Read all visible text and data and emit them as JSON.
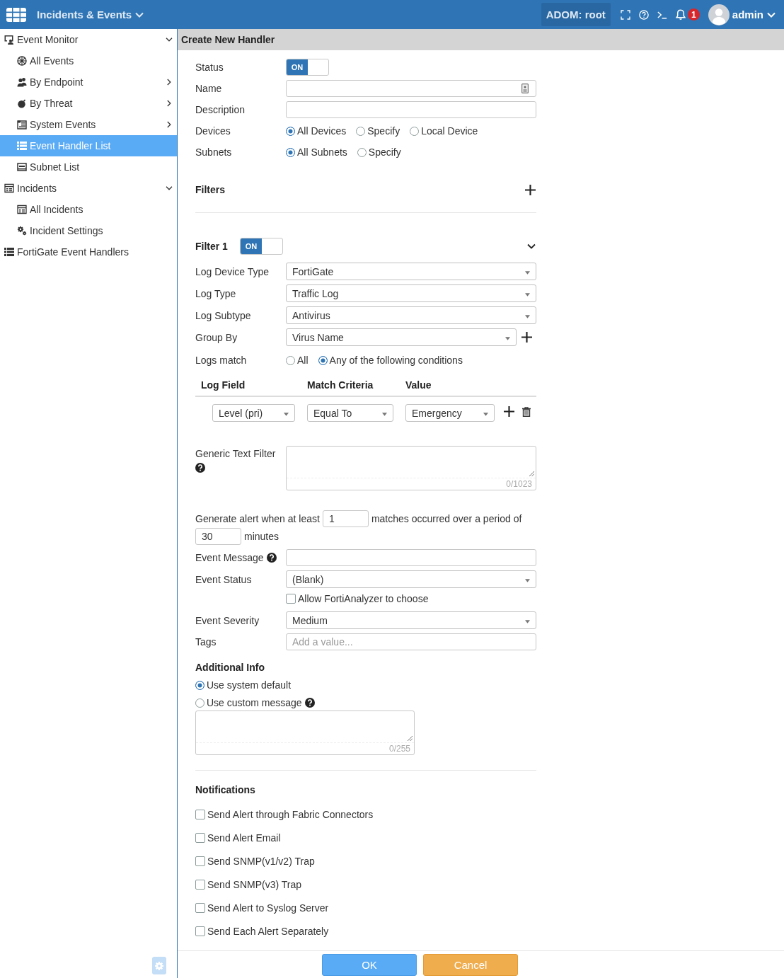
{
  "top_bar": {
    "app_title": "Incidents & Events",
    "adom": "ADOM: root",
    "alert_count": "1",
    "user": "admin"
  },
  "sidebar": {
    "items": [
      {
        "label": "Event Monitor",
        "kind": "branch",
        "expanded": true,
        "selected": false,
        "children": [
          {
            "label": "All Events",
            "kind": "leaf",
            "selected": false
          },
          {
            "label": "By Endpoint",
            "kind": "branch",
            "expanded": false,
            "selected": false
          },
          {
            "label": "By Threat",
            "kind": "branch",
            "expanded": false,
            "selected": false
          },
          {
            "label": "System Events",
            "kind": "branch",
            "expanded": false,
            "selected": false
          },
          {
            "label": "Event Handler List",
            "kind": "leaf",
            "selected": true
          },
          {
            "label": "Subnet List",
            "kind": "leaf",
            "selected": false
          }
        ]
      },
      {
        "label": "Incidents",
        "kind": "branch",
        "expanded": true,
        "selected": false,
        "children": [
          {
            "label": "All Incidents",
            "kind": "leaf",
            "selected": false
          },
          {
            "label": "Incident Settings",
            "kind": "leaf",
            "selected": false
          }
        ]
      },
      {
        "label": "FortiGate Event Handlers",
        "kind": "leaf",
        "selected": false
      }
    ]
  },
  "panel": {
    "title": "Create New Handler"
  },
  "general": [
    {
      "kind": "toggle",
      "label": "Status",
      "on": true,
      "toggle_text": "ON"
    },
    {
      "kind": "lookup",
      "label": "Name"
    },
    {
      "kind": "input",
      "label": "Description"
    },
    {
      "kind": "radio",
      "label": "Devices",
      "options": [
        {
          "label": "All Devices",
          "selected": true
        },
        {
          "label": "Specify",
          "selected": false
        },
        {
          "label": "Local Device",
          "selected": false
        }
      ]
    },
    {
      "kind": "radio",
      "label": "Subnets",
      "options": [
        {
          "label": "All Subnets",
          "selected": true
        },
        {
          "label": "Specify",
          "selected": false
        }
      ]
    }
  ],
  "filters": {
    "title": "Filters",
    "items": [
      {
        "title": "Filter 1",
        "on": true,
        "toggle_text": "ON",
        "expanded": true,
        "fields": [
          {
            "kind": "select",
            "label": "Log Device Type",
            "value": "FortiGate"
          },
          {
            "kind": "select",
            "label": "Log Type",
            "value": "Traffic Log"
          },
          {
            "kind": "select",
            "label": "Log Subtype",
            "value": "Antivirus"
          },
          {
            "kind": "selectadd",
            "label": "Group By",
            "value": "Virus Name"
          },
          {
            "kind": "radio",
            "label": "Logs match",
            "options": [
              {
                "label": "All",
                "selected": false
              },
              {
                "label": "Any of the following conditions",
                "selected": true
              }
            ]
          }
        ],
        "conditions": {
          "columns": [
            "Log Field",
            "Match Criteria",
            "Value"
          ],
          "rows": [
            {
              "log_field": "Level (pri)",
              "match_criteria": "Equal To",
              "value": "Emergency"
            }
          ]
        },
        "text_filter": {
          "label": "Generic Text Filter",
          "counter": "0/1023"
        }
      }
    ]
  },
  "alert_rule": {
    "prefix": "Generate alert when at least",
    "matches": "1",
    "middle": "matches occurred over a period of",
    "period": "30",
    "suffix": "minutes"
  },
  "event": [
    {
      "kind": "input",
      "label": "Event Message",
      "help": true
    },
    {
      "kind": "select",
      "label": "Event Status",
      "value": "(Blank)",
      "help": false
    },
    {
      "kind": "checkbox",
      "label": "Allow FortiAnalyzer to choose",
      "checked": false,
      "help": false
    },
    {
      "kind": "select",
      "label": "Event Severity",
      "value": "Medium",
      "help": false
    },
    {
      "kind": "input",
      "label": "Tags",
      "placeholder": "Add a value...",
      "help": false
    }
  ],
  "additional_info": {
    "title": "Additional Info",
    "options": [
      {
        "label": "Use system default",
        "selected": true,
        "help": false
      },
      {
        "label": "Use custom message",
        "selected": false,
        "help": true
      }
    ],
    "counter": "0/255"
  },
  "notifications": {
    "title": "Notifications",
    "options": [
      {
        "label": "Send Alert through Fabric Connectors",
        "checked": false
      },
      {
        "label": "Send Alert Email",
        "checked": false
      },
      {
        "label": "Send SNMP(v1/v2) Trap",
        "checked": false
      },
      {
        "label": "Send SNMP(v3) Trap",
        "checked": false
      },
      {
        "label": "Send Alert to Syslog Server",
        "checked": false
      },
      {
        "label": "Send Each Alert Separately",
        "checked": false
      }
    ]
  },
  "footer": {
    "buttons": [
      {
        "label": "OK",
        "kind": "primary"
      },
      {
        "label": "Cancel",
        "kind": "cancel"
      }
    ]
  }
}
